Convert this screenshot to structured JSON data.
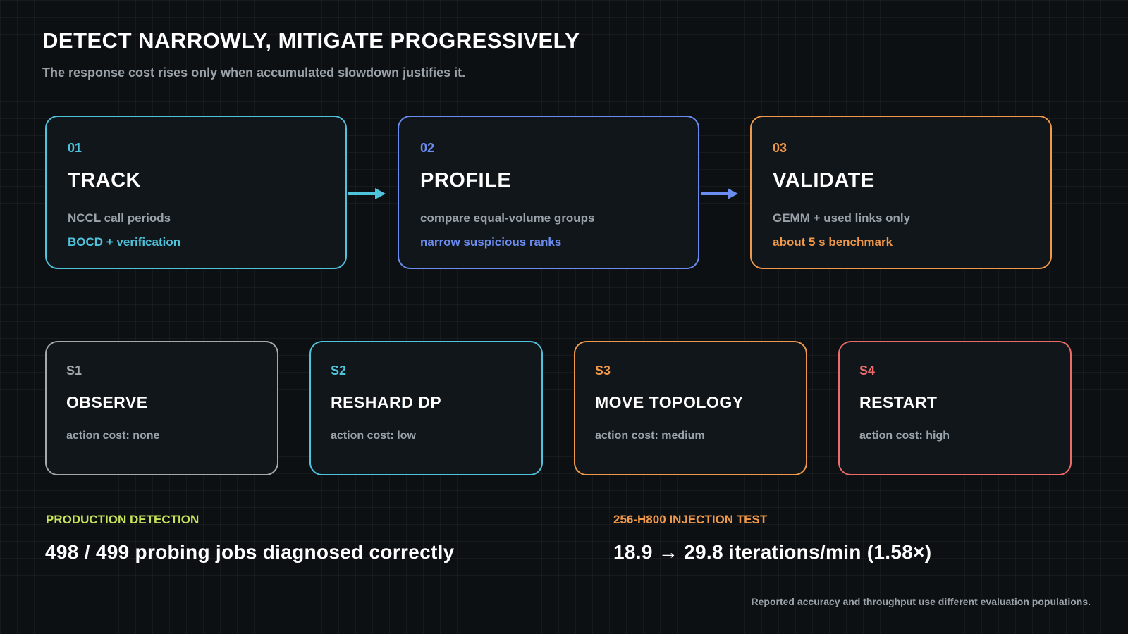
{
  "header": {
    "title": "DETECT NARROWLY, MITIGATE PROGRESSIVELY",
    "subtitle": "The response cost rises only when accumulated slowdown justifies it."
  },
  "stages": [
    {
      "num": "01",
      "name": "TRACK",
      "desc": "NCCL call periods",
      "highlight": "BOCD + verification",
      "color": "#4fc3dc"
    },
    {
      "num": "02",
      "name": "PROFILE",
      "desc": "compare equal-volume groups",
      "highlight": "narrow suspicious ranks",
      "color": "#6b8cf0"
    },
    {
      "num": "03",
      "name": "VALIDATE",
      "desc": "GEMM + used links only",
      "highlight": "about 5 s benchmark",
      "color": "#f0994a"
    }
  ],
  "tiers": [
    {
      "code": "S1",
      "name": "OBSERVE",
      "cost": "action cost: none",
      "color": "#a4a9ad"
    },
    {
      "code": "S2",
      "name": "RESHARD DP",
      "cost": "action cost: low",
      "color": "#4fc3dc"
    },
    {
      "code": "S3",
      "name": "MOVE TOPOLOGY",
      "cost": "action cost: medium",
      "color": "#f0994a"
    },
    {
      "code": "S4",
      "name": "RESTART",
      "cost": "action cost: high",
      "color": "#ee6b6b"
    }
  ],
  "metrics": [
    {
      "label": "PRODUCTION DETECTION",
      "value": "498 / 499 probing jobs diagnosed correctly",
      "color": "#c6e35a"
    },
    {
      "label": "256-H800 INJECTION TEST",
      "value": "18.9 → 29.8 iterations/min (1.58×)",
      "color": "#f0994a"
    }
  ],
  "footnote": "Reported accuracy and throughput use different evaluation populations.",
  "icons": {
    "stage_connector": "arrow-right-icon"
  }
}
